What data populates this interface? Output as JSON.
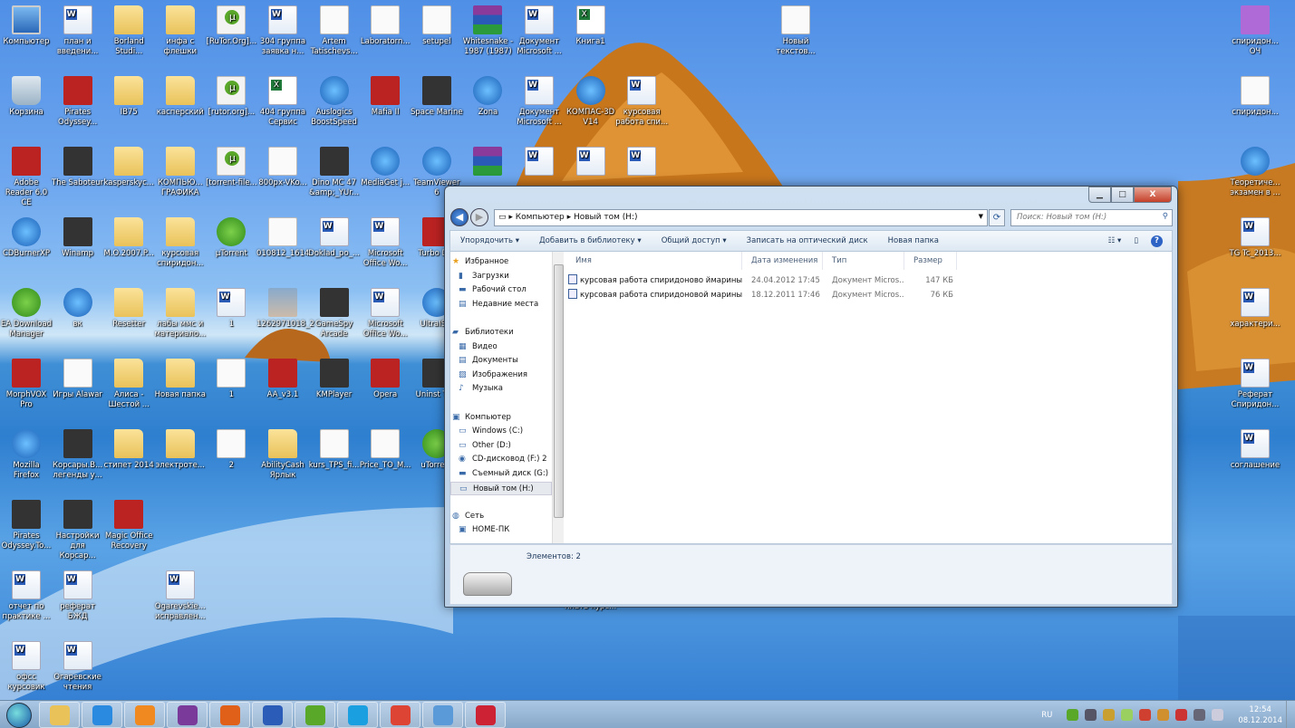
{
  "desktop": {
    "grid": [
      [
        [
          "pc",
          "Компьютер"
        ],
        [
          "word",
          "план и введени..."
        ],
        [
          "folder",
          "Borland Studi..."
        ],
        [
          "folder",
          "инфа с флешки"
        ],
        [
          "torrent",
          "[RuTor.Org]..."
        ],
        [
          "word",
          "304 группа заявка н..."
        ],
        [
          "txt",
          "Artem Tatischevs..."
        ],
        [
          "txt",
          "Laboratorn..."
        ],
        [
          "txt",
          "setupel"
        ],
        [
          "rar",
          "Whitesnake - 1987 (1987)"
        ],
        [
          "word",
          "Документ Microsoft ..."
        ],
        [
          "excel",
          "Книга1"
        ]
      ],
      [
        [
          "bin",
          "Корзина"
        ],
        [
          "red",
          "Pirates Odyssey..."
        ],
        [
          "folder",
          "IB75"
        ],
        [
          "folder",
          "касперский"
        ],
        [
          "torrent",
          "[rutor.org]..."
        ],
        [
          "excel",
          "404 группа Сервис"
        ],
        [
          "app",
          "Auslogics BoostSpeed"
        ],
        [
          "red",
          "Mafia II"
        ],
        [
          "dark",
          "Space Marine"
        ],
        [
          "app",
          "Zona"
        ],
        [
          "word",
          "Документ Microsoft ..."
        ],
        [
          "app",
          "КОМПАС-3D V14"
        ],
        [
          "word",
          "курсовая работа спи..."
        ]
      ],
      [
        [
          "red",
          "Adobe Reader 6.0 CE"
        ],
        [
          "dark",
          "The Saboteur"
        ],
        [
          "folder",
          "kasperskyc..."
        ],
        [
          "folder",
          "КОМПЬЮ... ГРАФИКА"
        ],
        [
          "torrent",
          "[torrent-file..."
        ],
        [
          "txt",
          "800px-VKo..."
        ],
        [
          "dark",
          "Dino MC 47 &amp;_YUr..."
        ],
        [
          "app",
          "MediaGet j..."
        ],
        [
          "app",
          "TeamViewer 6"
        ],
        [
          "rar",
          ""
        ],
        [
          "word",
          ""
        ],
        [
          "word",
          ""
        ],
        [
          "word",
          ""
        ]
      ],
      [
        [
          "app",
          "CDBurnerXP"
        ],
        [
          "dark",
          "Winamp"
        ],
        [
          "folder",
          "M.O.2007.P..."
        ],
        [
          "folder",
          "курсовая спиридон..."
        ],
        [
          "green",
          "µTorrent"
        ],
        [
          "txt",
          "010812_1614"
        ],
        [
          "word",
          "Doklad_po_..."
        ],
        [
          "word",
          "Microsoft Office Wo..."
        ],
        [
          "red",
          "Turbo D..."
        ]
      ],
      [
        [
          "green",
          "EA Download Manager"
        ],
        [
          "app",
          "вк"
        ],
        [
          "folder",
          "Resetter"
        ],
        [
          "folder",
          "лабы ммс и материало..."
        ],
        [
          "word",
          "1"
        ],
        [
          "img",
          "1262971018_2"
        ],
        [
          "dark",
          "GameSpy Arcade"
        ],
        [
          "word",
          "Microsoft Office Wo..."
        ],
        [
          "app",
          "UltraIS..."
        ]
      ],
      [
        [
          "red",
          "MorphVOX Pro"
        ],
        [
          "txt",
          "Игры Alawar"
        ],
        [
          "folder",
          "Алиса - Шестой ..."
        ],
        [
          "folder",
          "Новая папка"
        ],
        [
          "txt",
          "1"
        ],
        [
          "red",
          "AA_v3.1"
        ],
        [
          "dark",
          "KMPlayer"
        ],
        [
          "red",
          "Opera"
        ],
        [
          "dark",
          "Uninst Tool"
        ]
      ],
      [
        [
          "app",
          "Mozilla Firefox"
        ],
        [
          "dark",
          "Корсары.В... легенды у..."
        ],
        [
          "folder",
          "стипет 2014"
        ],
        [
          "folder",
          "электроте..."
        ],
        [
          "txt",
          "2"
        ],
        [
          "folder",
          "AbilityCash Ярлык"
        ],
        [
          "txt",
          "kurs_TPS_fi..."
        ],
        [
          "txt",
          "Price_TO_M..."
        ],
        [
          "green",
          "uTorrent"
        ]
      ],
      [
        [
          "dark",
          "Pirates Odyssey.To..."
        ],
        [
          "dark",
          "Настройки для Корсар..."
        ],
        [
          "red",
          "Magic Office Recovery"
        ]
      ],
      [
        [
          "word",
          "отчет по практике ..."
        ],
        [
          "word",
          "реферат БЖД"
        ],
        null,
        [
          "word",
          "Ogarevskie... исправлен..."
        ],
        null,
        null,
        null,
        null,
        null,
        null,
        null,
        [
          "word",
          "плать курс..."
        ]
      ],
      [
        [
          "word",
          "офсс курсовик"
        ],
        [
          "word",
          "Огаревские чтения"
        ]
      ]
    ],
    "extra_top": [
      "txt",
      "Новый текстов..."
    ],
    "right_column": [
      [
        "pink",
        "спиридон... ОЧ"
      ],
      [
        "txt",
        "спиридон..."
      ],
      [
        "app",
        "Теоретиче... экзамен в ..."
      ],
      [
        "word",
        "TG Tc_2013..."
      ],
      [
        "word",
        "характери..."
      ],
      [
        "word",
        "Реферат Спиридон..."
      ],
      [
        "word",
        "соглашение"
      ]
    ]
  },
  "explorer": {
    "buttons": {
      "minimize": "▁",
      "maximize": "□",
      "close": "X"
    },
    "breadcrumb": [
      "Компьютер",
      "Новый том (H:)"
    ],
    "search_placeholder": "Поиск: Новый том (H:)",
    "toolbar": [
      "Упорядочить ▾",
      "Добавить в библиотеку ▾",
      "Общий доступ ▾",
      "Записать на оптический диск",
      "Новая папка"
    ],
    "tree": [
      {
        "label": "Избранное",
        "head": true,
        "icon": "★"
      },
      {
        "label": "Загрузки",
        "icon": "▮"
      },
      {
        "label": "Рабочий стол",
        "icon": "▬"
      },
      {
        "label": "Недавние места",
        "icon": "▤"
      },
      null,
      {
        "label": "Библиотеки",
        "head": true,
        "icon": "▰"
      },
      {
        "label": "Видео",
        "icon": "▦"
      },
      {
        "label": "Документы",
        "icon": "▤"
      },
      {
        "label": "Изображения",
        "icon": "▨"
      },
      {
        "label": "Музыка",
        "icon": "♪"
      },
      null,
      {
        "label": "Компьютер",
        "head": true,
        "icon": "▣"
      },
      {
        "label": "Windows (C:)",
        "icon": "▭"
      },
      {
        "label": "Other (D:)",
        "icon": "▭"
      },
      {
        "label": "CD-дисковод (F:) 2",
        "icon": "◉"
      },
      {
        "label": "Съемный диск (G:)",
        "icon": "▬"
      },
      {
        "label": "Новый том (H:)",
        "icon": "▭",
        "selected": true
      },
      null,
      {
        "label": "Сеть",
        "head": true,
        "icon": "◍"
      },
      {
        "label": "HOME-ПК",
        "icon": "▣"
      }
    ],
    "columns": [
      "Имя",
      "Дата изменения",
      "Тип",
      "Размер"
    ],
    "files": [
      [
        "курсовая работа спиридоново ймарины",
        "24.04.2012 17:45",
        "Документ Micros...",
        "147 КБ"
      ],
      [
        "курсовая работа спиридоновой марины.",
        "18.12.2011 17:46",
        "Документ Micros...",
        "76 КБ"
      ]
    ],
    "status": "Элементов: 2"
  },
  "taskbar": {
    "items": [
      [
        "explorer",
        "#e9c25a"
      ],
      [
        "internet-explorer",
        "#2a8ae0"
      ],
      [
        "media-player",
        "#f08a20"
      ],
      [
        "winrar",
        "#7a3a9a"
      ],
      [
        "firefox",
        "#e0601a"
      ],
      [
        "word",
        "#2a5cb8"
      ],
      [
        "utorrent",
        "#5aa82a"
      ],
      [
        "skype",
        "#1aa0e0"
      ],
      [
        "chrome",
        "#dd4433"
      ],
      [
        "control-panel",
        "#5a9ad8"
      ],
      [
        "kompas",
        "#cc2233"
      ]
    ],
    "lang": "RU",
    "tray_icons": [
      "#5aa82a",
      "#556",
      "#c9a030",
      "#9ad060",
      "#d04030",
      "#d09030",
      "#c33",
      "#667",
      "#ccd"
    ],
    "time": "12:54",
    "date": "08.12.2014"
  }
}
